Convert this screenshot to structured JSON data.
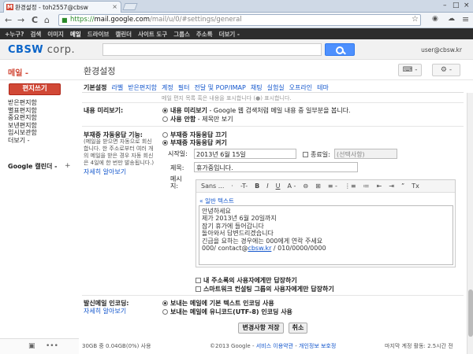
{
  "browser": {
    "tab_title": "환경설정 - toh2557@cbsw",
    "tab_close": "×",
    "url_https": "https://",
    "url_domain": "mail.google.com",
    "url_path": "/mail/u/0/#settings/general",
    "back_glyph": "←",
    "forward_glyph": "→",
    "reload_glyph": "C",
    "home_glyph": "⌂",
    "star_glyph": "☆",
    "menu_glyph": "≡"
  },
  "gbar": {
    "items": [
      "+누구?",
      "검색",
      "이미지",
      "메일",
      "드라이브",
      "캘린더",
      "사이트 도구",
      "그룹스",
      "주소록",
      "더보기 -"
    ],
    "active_index": 3
  },
  "header": {
    "logo_a": "CBSW",
    "logo_b": " corp.",
    "account": "user@cbsw.kr"
  },
  "subheader": {
    "mail_label": "메일 -",
    "page_title": "환경설정",
    "keyboard_glyph": "⌨ -",
    "gear_glyph": "⚙ -"
  },
  "sidebar": {
    "compose": "편지쓰기",
    "items": [
      "받은편지함",
      "별표편지함",
      "중요편지함",
      "보낸편지함",
      "임시보관함",
      "더보기 -"
    ],
    "calendar": "Google 캘린더 -",
    "plus": "+"
  },
  "settings_tabs": {
    "items": [
      "기본설정",
      "라벨",
      "받은편지함",
      "계정",
      "필터",
      "전달 및 POP/IMAP",
      "채팅",
      "실험실",
      "오프라인",
      "테마"
    ],
    "active_index": 0
  },
  "cut_text": "메일 편지 목록 혹은 내용을 표시합니다 (●) 표시합니다.",
  "preview": {
    "label": "내용 미리보기:",
    "opt_on_bold": "내용 미리보기",
    "opt_on_rest": " - Google 웹 검색처럼 메일 내용 중 일부분을 봅니다.",
    "opt_off_bold": "사용 안함",
    "opt_off_rest": " - 제목만 보기"
  },
  "vacation": {
    "label": "부재중 자동응답 기능:",
    "desc": [
      "(메일을 받으면 자동으로 회신",
      "합니다. 한 주소로부터 여러 개",
      "의 메일을 받은 경우 자동 회신",
      "은 4일에 한 번만 발송됩니다.)"
    ],
    "learn_more": "자세히 알아보기",
    "opt_off": "부재중 자동응답 끄기",
    "opt_on": "부재중 자동응답 켜기",
    "start_label": "시작일:",
    "start_value": "2013년 6월 15일",
    "end_label": "종료일:",
    "end_value": "(선택사항)",
    "subject_label": "제목:",
    "subject_value": "휴가중입니다.",
    "message_label": "메시지:",
    "toolbar": [
      "Sans ...",
      "·",
      "-T-",
      "B",
      "I",
      "U",
      "A -",
      "⊖",
      "⊞",
      "≡ -",
      "⋮≡",
      "≔",
      "⇤",
      "⇥",
      "”",
      "Tx"
    ],
    "plain_text_link": "« 일반 텍스트",
    "body_lines": [
      "안녕하세요",
      "제가 2013년 6월 20일까지",
      "잠기 휴가에 들어갑니다",
      "돌아와서 답변드리겠습니다",
      "긴급을 요하는 경우에는 000에게 연락 주세요"
    ],
    "body_contact_pre": "000/ contact@",
    "body_contact_link": "cbsw.kr",
    "body_contact_post": " / 010/0000/0000",
    "only_contacts": "내 주소록의 사용자에게만 답장하기",
    "only_domain": "스마트워크 컨설팅 그룹의 사용자에게만 답장하기"
  },
  "encoding": {
    "label": "발신메일 인코딩:",
    "learn_more": "자세히 알아보기",
    "opt_default": "보내는 메일에 기본 텍스트 인코딩 사용",
    "opt_utf8": "보내는 메일에 유니코드(UTF-8) 인코딩 사용"
  },
  "actions": {
    "save": "변경사항 저장",
    "cancel": "취소"
  },
  "footer": {
    "storage": "30GB 중 0.04GB(0%) 사용",
    "copyright": "©2013 Google - ",
    "terms": "서비스 이용약관",
    "sep": " - ",
    "privacy": "개인정보 보호정",
    "last_activity": "마지막 계정 활동: 2.5시간 전"
  },
  "bottom_left": {
    "icon1": "▣",
    "icon2": "•••"
  }
}
